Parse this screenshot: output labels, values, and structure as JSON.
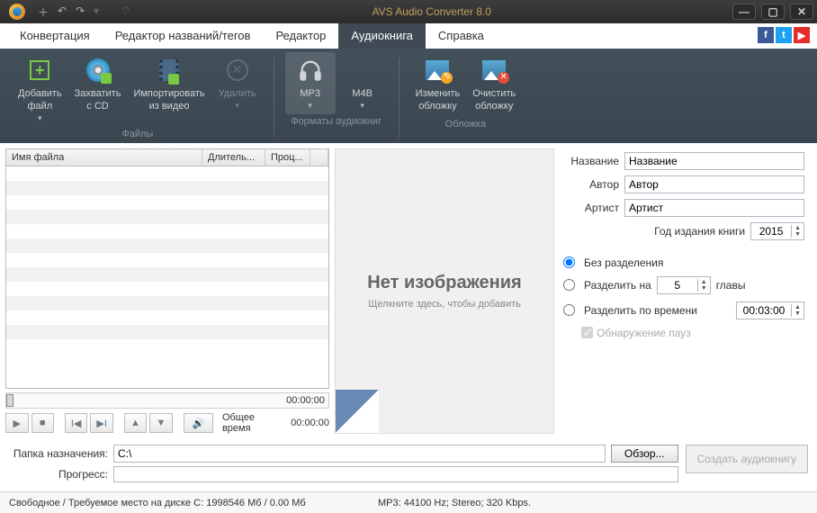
{
  "titlebar": {
    "title": "AVS Audio Converter  8.0"
  },
  "tabs": {
    "convert": "Конвертация",
    "tageditor": "Редактор названий/тегов",
    "editor": "Редактор",
    "audiobook": "Аудиокнига",
    "help": "Справка"
  },
  "ribbon": {
    "add_file": "Добавить\nфайл",
    "grab_cd": "Захватить\nс CD",
    "import_video": "Импортировать\nиз видео",
    "delete": "Удалить",
    "group_files": "Файлы",
    "mp3": "MP3",
    "m4b": "M4B",
    "group_formats": "Форматы аудиокниг",
    "change_cover": "Изменить\nобложку",
    "clear_cover": "Очистить\nобложку",
    "group_cover": "Обложка"
  },
  "filelist": {
    "col_name": "Имя файла",
    "col_duration": "Длитель...",
    "col_proc": "Проц...",
    "timeline_time": "00:00:00",
    "total_label": "Общее время",
    "total_time": "00:00:00"
  },
  "cover": {
    "no_image": "Нет изображения",
    "click_hint": "Щелкните здесь, чтобы добавить"
  },
  "meta": {
    "title_label": "Название",
    "title_value": "Название",
    "author_label": "Автор",
    "author_value": "Автор",
    "artist_label": "Артист",
    "artist_value": "Артист",
    "year_label": "Год издания книги",
    "year_value": "2015"
  },
  "split": {
    "no_split": "Без разделения",
    "split_into": "Разделить на",
    "chapters_count": "5",
    "chapters_word": "главы",
    "split_time": "Разделить по времени",
    "time_value": "00:03:00",
    "detect_pause": "Обнаружение пауз"
  },
  "bottom": {
    "dest_label": "Папка назначения:",
    "dest_value": "C:\\",
    "browse": "Обзор...",
    "progress_label": "Прогресс:",
    "create": "Создать аудиокнигу"
  },
  "status": {
    "disk": "Свободное / Требуемое место на диске C: 1998546 Мб / 0.00 Мб",
    "format": "MP3: 44100  Hz; Stereo; 320 Kbps."
  }
}
